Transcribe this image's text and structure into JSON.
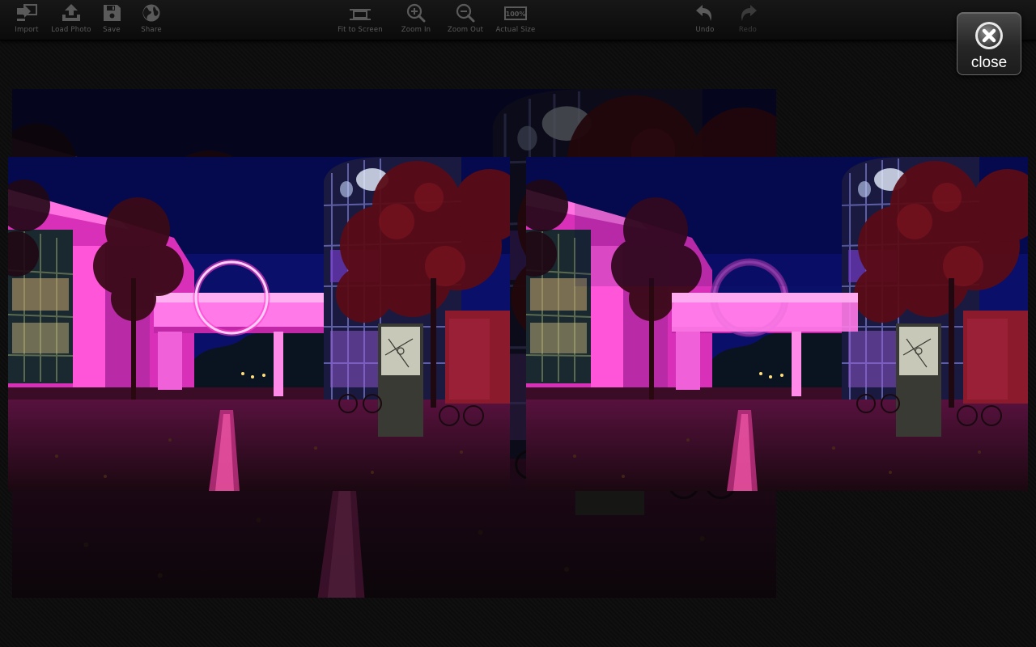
{
  "toolbar": {
    "left_tools": [
      {
        "label": "Import",
        "icon": "import-icon"
      },
      {
        "label": "Load Photo",
        "icon": "upload-icon"
      },
      {
        "label": "Save",
        "icon": "floppy-save-icon"
      },
      {
        "label": "Share",
        "icon": "globe-share-icon"
      }
    ],
    "view_tools": [
      {
        "label": "Fit to Screen",
        "icon": "fit-screen-icon"
      },
      {
        "label": "Zoom In",
        "icon": "zoom-in-icon"
      },
      {
        "label": "Zoom Out",
        "icon": "zoom-out-icon"
      },
      {
        "label": "Actual Size",
        "icon": "actual-size-icon",
        "badge": "100%"
      }
    ],
    "history_tools": [
      {
        "label": "Undo",
        "icon": "undo-icon"
      },
      {
        "label": "Redo",
        "icon": "redo-icon",
        "disabled": true
      }
    ]
  },
  "close_button": {
    "label": "close",
    "icon": "close-x-icon"
  },
  "colors": {
    "toolbar_icon": "#5a5a5a",
    "toolbar_label": "#5c5c5c",
    "neon_pink": "#ff3fd0",
    "night_sky": "#0a0f6a"
  },
  "canvas": {
    "photos": [
      "background-preview",
      "original-photo",
      "edited-photo"
    ]
  }
}
